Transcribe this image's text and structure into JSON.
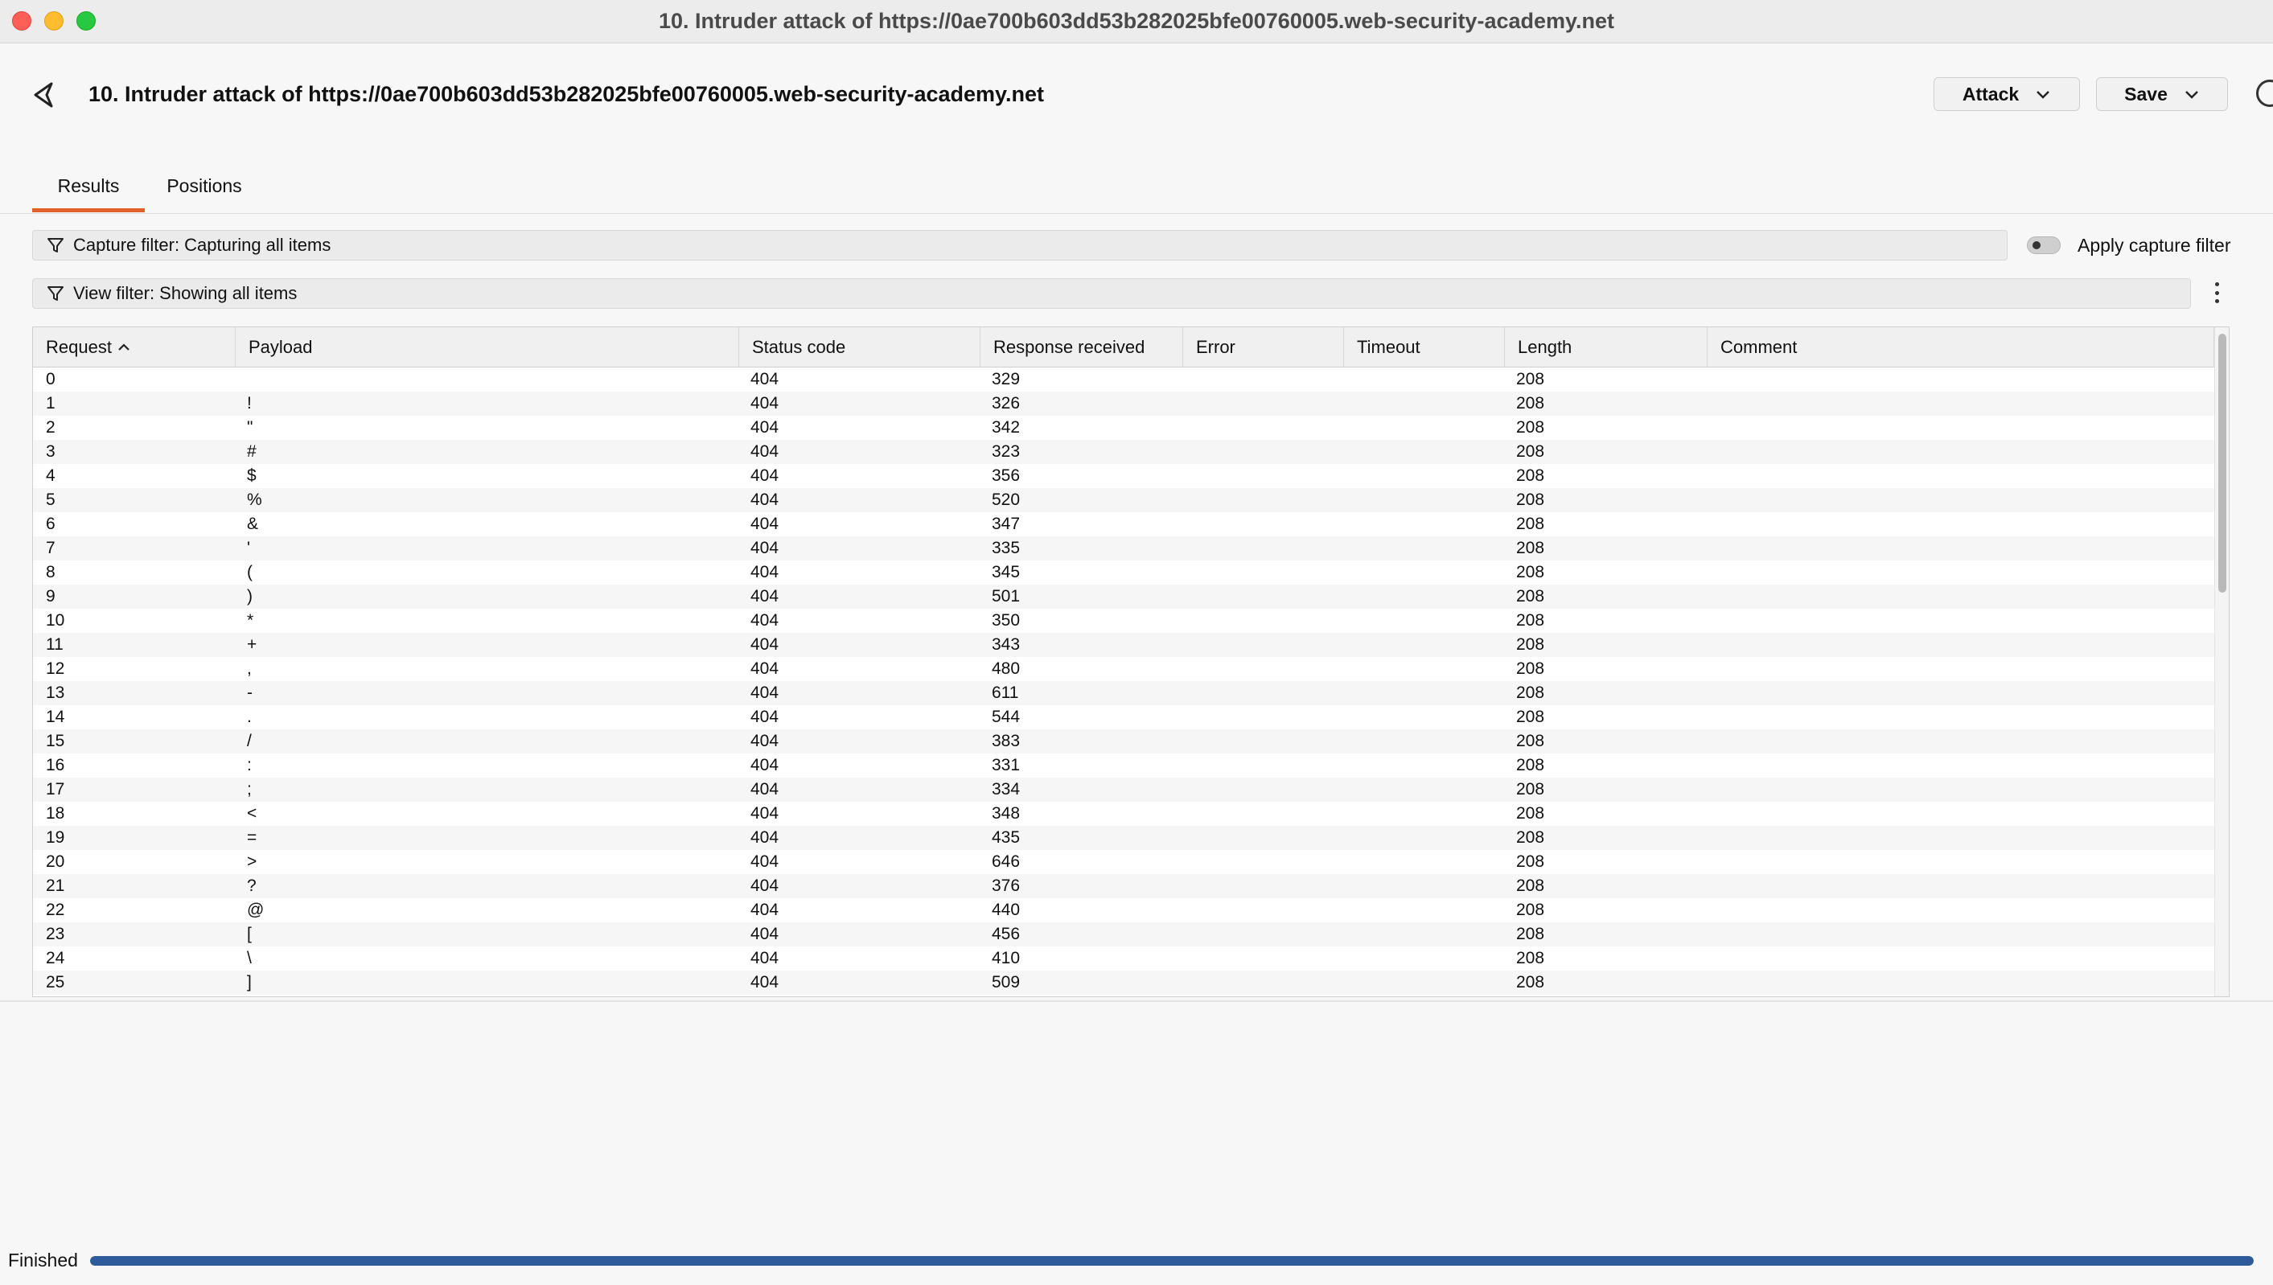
{
  "window": {
    "title": "10. Intruder attack of https://0ae700b603dd53b282025bfe00760005.web-security-academy.net"
  },
  "header": {
    "title": "10. Intruder attack of https://0ae700b603dd53b282025bfe00760005.web-security-academy.net",
    "attack_label": "Attack",
    "save_label": "Save"
  },
  "tabs": [
    {
      "label": "Results",
      "active": true
    },
    {
      "label": "Positions",
      "active": false
    }
  ],
  "capture_filter": {
    "text": "Capture filter: Capturing all items",
    "apply_label": "Apply capture filter",
    "apply_enabled": false
  },
  "view_filter": {
    "text": "View filter: Showing all items"
  },
  "table": {
    "columns": [
      "Request",
      "Payload",
      "Status code",
      "Response received",
      "Error",
      "Timeout",
      "Length",
      "Comment"
    ],
    "sort_column": "Request",
    "sort_direction": "ascending",
    "rows": [
      {
        "request": "0",
        "payload": "",
        "status": "404",
        "received": "329",
        "error": "",
        "timeout": "",
        "length": "208",
        "comment": ""
      },
      {
        "request": "1",
        "payload": "!",
        "status": "404",
        "received": "326",
        "error": "",
        "timeout": "",
        "length": "208",
        "comment": ""
      },
      {
        "request": "2",
        "payload": "\"",
        "status": "404",
        "received": "342",
        "error": "",
        "timeout": "",
        "length": "208",
        "comment": ""
      },
      {
        "request": "3",
        "payload": "#",
        "status": "404",
        "received": "323",
        "error": "",
        "timeout": "",
        "length": "208",
        "comment": ""
      },
      {
        "request": "4",
        "payload": "$",
        "status": "404",
        "received": "356",
        "error": "",
        "timeout": "",
        "length": "208",
        "comment": ""
      },
      {
        "request": "5",
        "payload": "%",
        "status": "404",
        "received": "520",
        "error": "",
        "timeout": "",
        "length": "208",
        "comment": ""
      },
      {
        "request": "6",
        "payload": "&",
        "status": "404",
        "received": "347",
        "error": "",
        "timeout": "",
        "length": "208",
        "comment": ""
      },
      {
        "request": "7",
        "payload": "'",
        "status": "404",
        "received": "335",
        "error": "",
        "timeout": "",
        "length": "208",
        "comment": ""
      },
      {
        "request": "8",
        "payload": "(",
        "status": "404",
        "received": "345",
        "error": "",
        "timeout": "",
        "length": "208",
        "comment": ""
      },
      {
        "request": "9",
        "payload": ")",
        "status": "404",
        "received": "501",
        "error": "",
        "timeout": "",
        "length": "208",
        "comment": ""
      },
      {
        "request": "10",
        "payload": "*",
        "status": "404",
        "received": "350",
        "error": "",
        "timeout": "",
        "length": "208",
        "comment": ""
      },
      {
        "request": "11",
        "payload": "+",
        "status": "404",
        "received": "343",
        "error": "",
        "timeout": "",
        "length": "208",
        "comment": ""
      },
      {
        "request": "12",
        "payload": ",",
        "status": "404",
        "received": "480",
        "error": "",
        "timeout": "",
        "length": "208",
        "comment": ""
      },
      {
        "request": "13",
        "payload": "-",
        "status": "404",
        "received": "611",
        "error": "",
        "timeout": "",
        "length": "208",
        "comment": ""
      },
      {
        "request": "14",
        "payload": ".",
        "status": "404",
        "received": "544",
        "error": "",
        "timeout": "",
        "length": "208",
        "comment": ""
      },
      {
        "request": "15",
        "payload": "/",
        "status": "404",
        "received": "383",
        "error": "",
        "timeout": "",
        "length": "208",
        "comment": ""
      },
      {
        "request": "16",
        "payload": ":",
        "status": "404",
        "received": "331",
        "error": "",
        "timeout": "",
        "length": "208",
        "comment": ""
      },
      {
        "request": "17",
        "payload": ";",
        "status": "404",
        "received": "334",
        "error": "",
        "timeout": "",
        "length": "208",
        "comment": ""
      },
      {
        "request": "18",
        "payload": "<",
        "status": "404",
        "received": "348",
        "error": "",
        "timeout": "",
        "length": "208",
        "comment": ""
      },
      {
        "request": "19",
        "payload": "=",
        "status": "404",
        "received": "435",
        "error": "",
        "timeout": "",
        "length": "208",
        "comment": ""
      },
      {
        "request": "20",
        "payload": ">",
        "status": "404",
        "received": "646",
        "error": "",
        "timeout": "",
        "length": "208",
        "comment": ""
      },
      {
        "request": "21",
        "payload": "?",
        "status": "404",
        "received": "376",
        "error": "",
        "timeout": "",
        "length": "208",
        "comment": ""
      },
      {
        "request": "22",
        "payload": "@",
        "status": "404",
        "received": "440",
        "error": "",
        "timeout": "",
        "length": "208",
        "comment": ""
      },
      {
        "request": "23",
        "payload": "[",
        "status": "404",
        "received": "456",
        "error": "",
        "timeout": "",
        "length": "208",
        "comment": ""
      },
      {
        "request": "24",
        "payload": "\\",
        "status": "404",
        "received": "410",
        "error": "",
        "timeout": "",
        "length": "208",
        "comment": ""
      },
      {
        "request": "25",
        "payload": "]",
        "status": "404",
        "received": "509",
        "error": "",
        "timeout": "",
        "length": "208",
        "comment": ""
      }
    ]
  },
  "status": {
    "label": "Finished",
    "progress": 1.0
  },
  "colors": {
    "tab_accent": "#e1602b",
    "progress_fill": "#2f5b9a",
    "traffic_close": "#fe5f57",
    "traffic_minimize": "#febc2e",
    "traffic_maximize": "#28c840"
  },
  "icons": {
    "back": "back-arrow-icon",
    "chevron": "chevron-down-icon",
    "help": "help-icon",
    "filter": "funnel-icon",
    "more": "kebab-menu-icon",
    "sort": "sort-ascending-icon"
  }
}
